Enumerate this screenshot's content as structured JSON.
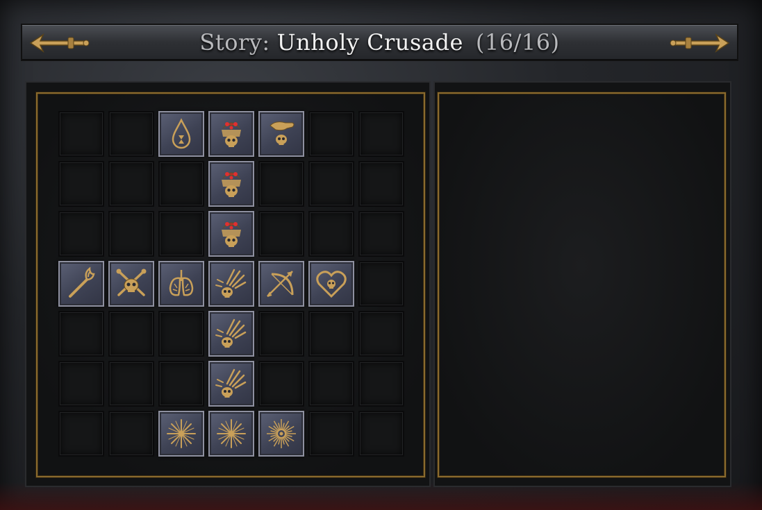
{
  "header": {
    "title_prefix": "Story:",
    "title_name": "Unholy Crusade",
    "title_count": "(16/16)",
    "prev_icon": "ornate-arrow-left-icon",
    "next_icon": "ornate-arrow-right-icon"
  },
  "colors": {
    "gold": "#c9a059",
    "tile": "#4a4e63",
    "tile_border": "#8e90a0",
    "empty_cell": "#151617",
    "frame_gold": "#8a6a2e"
  },
  "grid": {
    "rows": 7,
    "cols": 7,
    "nodes": [
      {
        "row": 0,
        "col": 2,
        "icon": "hourglass-drop-icon"
      },
      {
        "row": 0,
        "col": 3,
        "icon": "flaming-skull-icon"
      },
      {
        "row": 0,
        "col": 4,
        "icon": "hand-skull-icon"
      },
      {
        "row": 1,
        "col": 3,
        "icon": "flaming-skull-icon"
      },
      {
        "row": 2,
        "col": 3,
        "icon": "flaming-skull-icon"
      },
      {
        "row": 3,
        "col": 0,
        "icon": "torch-icon"
      },
      {
        "row": 3,
        "col": 1,
        "icon": "skull-crossbones-icon"
      },
      {
        "row": 3,
        "col": 2,
        "icon": "lungs-icon"
      },
      {
        "row": 3,
        "col": 3,
        "icon": "claw-skull-icon"
      },
      {
        "row": 3,
        "col": 4,
        "icon": "bow-arrow-icon"
      },
      {
        "row": 3,
        "col": 5,
        "icon": "heart-skull-icon"
      },
      {
        "row": 4,
        "col": 3,
        "icon": "claw-skull-icon"
      },
      {
        "row": 5,
        "col": 3,
        "icon": "claw-skull-icon"
      },
      {
        "row": 6,
        "col": 2,
        "icon": "starburst-icon"
      },
      {
        "row": 6,
        "col": 3,
        "icon": "starburst-icon"
      },
      {
        "row": 6,
        "col": 4,
        "icon": "sunburst-icon"
      }
    ]
  },
  "detail_panel": {}
}
